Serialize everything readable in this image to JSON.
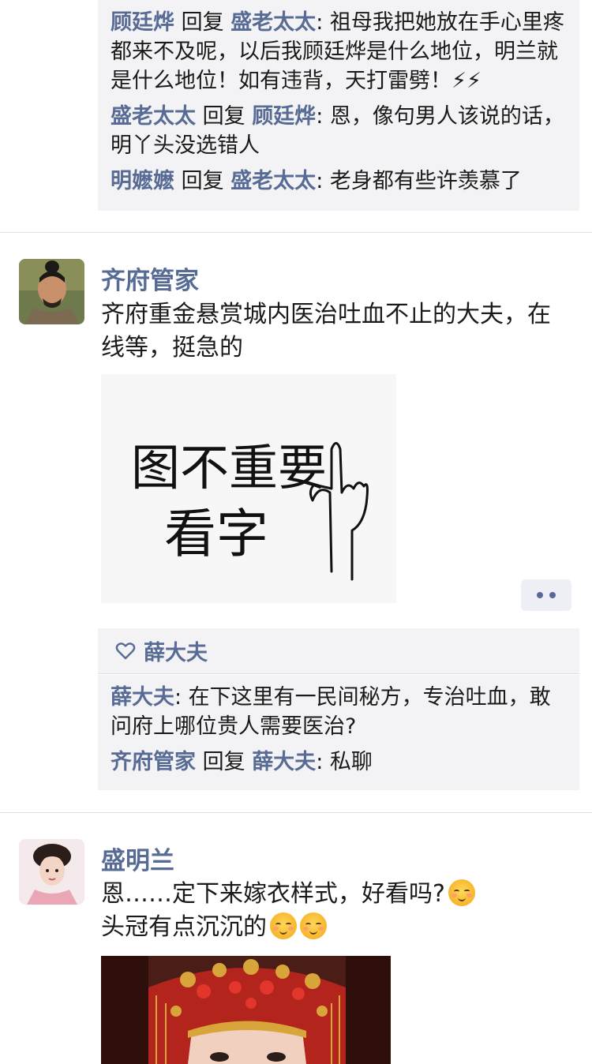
{
  "top_comments": [
    {
      "from": "顾廷烨",
      "reply_word": "回复",
      "to": "盛老太太",
      "text": ": 祖母我把她放在手心里疼都来不及呢，以后我顾廷烨是什么地位，明兰就是什么地位！如有违背，天打雷劈！⚡⚡"
    },
    {
      "from": "盛老太太",
      "reply_word": "回复",
      "to": "顾廷烨",
      "text": ": 恩，像句男人该说的话，明丫头没选错人"
    },
    {
      "from": "明嬷嬷",
      "reply_word": "回复",
      "to": "盛老太太",
      "text": ": 老身都有些许羡慕了"
    }
  ],
  "post1": {
    "name": "齐府管家",
    "text": "齐府重金悬赏城内医治吐血不止的大夫，在线等，挺急的",
    "image_text_line1": "图不重要",
    "image_text_line2": "看字",
    "like_icon": "heart-outline-icon",
    "likes": "薛大夫",
    "comments": [
      {
        "from": "薛大夫",
        "reply_word": "",
        "to": "",
        "text": ": 在下这里有一民间秘方，专治吐血，敢问府上哪位贵人需要医治?"
      },
      {
        "from": "齐府管家",
        "reply_word": "回复",
        "to": "薛大夫",
        "text": ": 私聊"
      }
    ]
  },
  "post2": {
    "name": "盛明兰",
    "text_line1": "恩……定下来嫁衣样式，好看吗?",
    "text_line2": "头冠有点沉沉的",
    "emoji": "blush-emoji-icon"
  },
  "colors": {
    "link": "#576b95",
    "comment_bg": "#f3f3f5"
  }
}
